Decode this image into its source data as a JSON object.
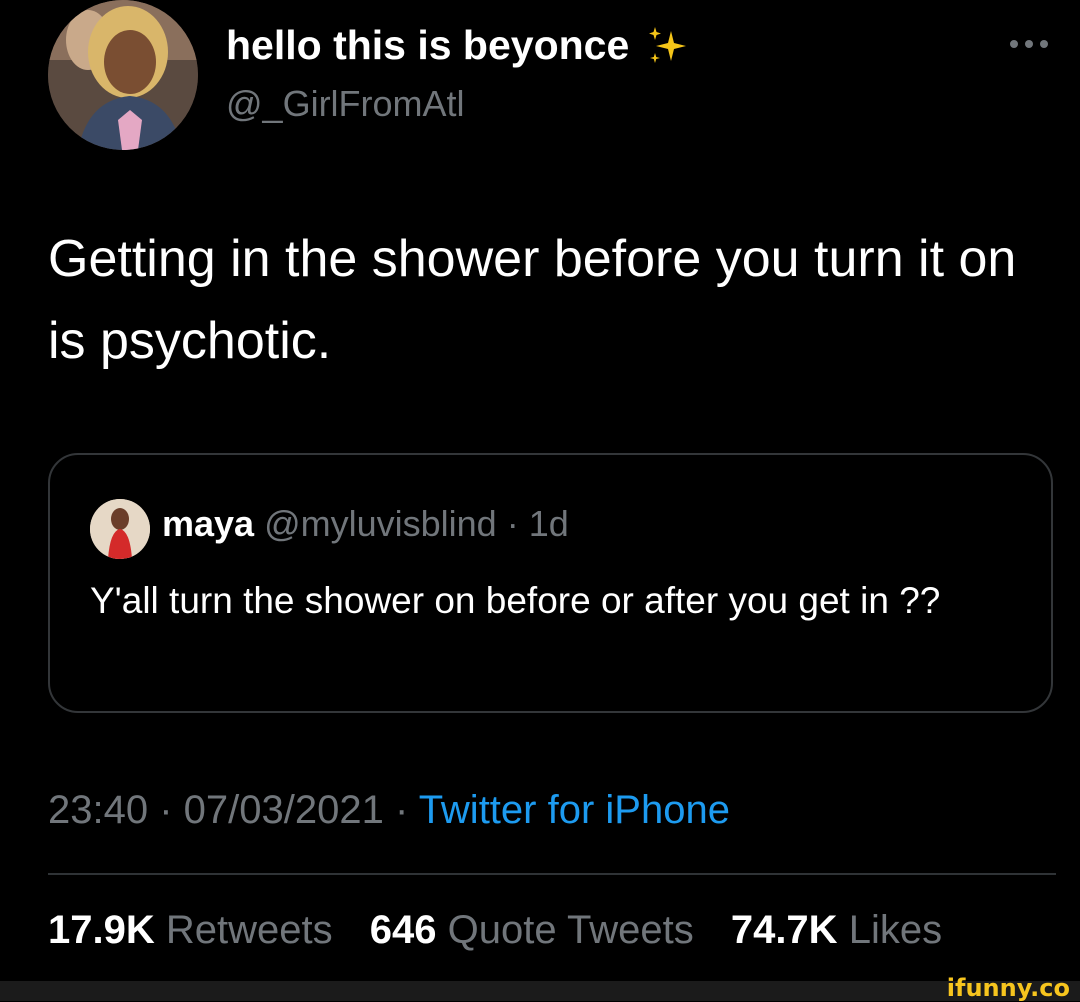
{
  "author": {
    "display_name": "hello this is beyonce",
    "name_icon": "sparkles-icon",
    "handle": "@_GirlFromAtl",
    "avatar": "profile-photo"
  },
  "menu": {
    "icon": "more-options-icon"
  },
  "tweet": {
    "text": "Getting in the shower before you turn it on is psychotic."
  },
  "quoted_tweet": {
    "avatar": "profile-photo",
    "name": "maya",
    "handle": "@myluvisblind",
    "separator": " · ",
    "age": "1d",
    "text": "Y'all turn the shower on before or after you get in ??"
  },
  "meta": {
    "time": "23:40",
    "separator": " · ",
    "date": "07/03/2021",
    "source": "Twitter for iPhone"
  },
  "stats": {
    "retweets_count": "17.9K",
    "retweets_label": "Retweets",
    "quotes_count": "646",
    "quotes_label": "Quote Tweets",
    "likes_count": "74.7K",
    "likes_label": "Likes"
  },
  "watermark": "ifunny.co",
  "colors": {
    "background": "#000000",
    "primary_text": "#ffffff",
    "secondary_text": "#71767b",
    "link": "#1d9bf0",
    "border": "#333639",
    "watermark": "#f7c51e"
  }
}
